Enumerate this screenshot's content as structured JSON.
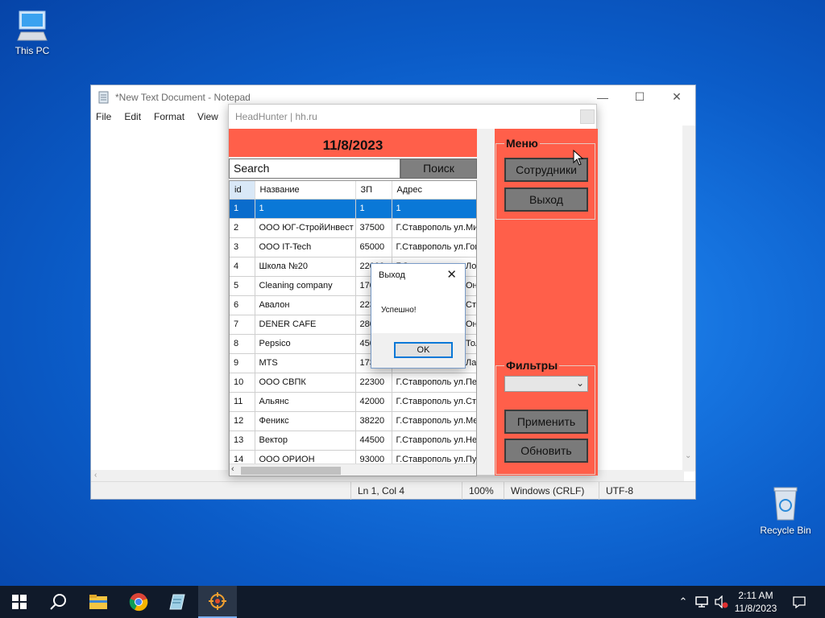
{
  "desktop": {
    "this_pc_label": "This PC",
    "recycle_bin_label": "Recycle Bin"
  },
  "notepad": {
    "title": "*New Text Document - Notepad",
    "menu": [
      "File",
      "Edit",
      "Format",
      "View",
      "H"
    ],
    "status": {
      "position": "Ln 1, Col 4",
      "zoom": "100%",
      "line_ending": "Windows (CRLF)",
      "encoding": "UTF-8"
    }
  },
  "hh": {
    "title": "HeadHunter | hh.ru",
    "date": "11/8/2023",
    "search_placeholder": "Search",
    "search_button": "Поиск",
    "columns": [
      "id",
      "Название",
      "ЗП",
      "Адрес"
    ],
    "rows": [
      [
        "1",
        "1",
        "1",
        "1"
      ],
      [
        "2",
        "ООО ЮГ-СтройИнвест",
        "37500",
        "Г.Ставрополь ул.Мир"
      ],
      [
        "3",
        "ООО IT-Tech",
        "65000",
        "Г.Ставрополь ул.Гог"
      ],
      [
        "4",
        "Школа №20",
        "22000",
        "Г.Ставрополь ул.Лог"
      ],
      [
        "5",
        "Cleaning company",
        "17000",
        "Г.Ставрополь ул.Онс"
      ],
      [
        "6",
        "Авалон",
        "22300",
        "Г.Ставрополь ул.Сте"
      ],
      [
        "7",
        "DENER CAFE",
        "28000",
        "Г.Ставрополь ул.Онс"
      ],
      [
        "8",
        "Pepsico",
        "45000",
        "Г.Ставрополь ул.Тол"
      ],
      [
        "9",
        "MTS",
        "17300",
        "Г.Ставрополь ул.Лаз"
      ],
      [
        "10",
        "ООО СВПК",
        "22300",
        "Г.Ставрополь ул.Пен"
      ],
      [
        "11",
        "Альянс",
        "42000",
        "Г.Ставрополь ул.Сте"
      ],
      [
        "12",
        "Феникс",
        "38220",
        "Г.Ставрополь ул.Мел"
      ],
      [
        "13",
        "Вектор",
        "44500",
        "Г.Ставрополь ул.Нес"
      ],
      [
        "14",
        "ООО ОРИОН",
        "93000",
        "Г.Ставрополь ул.Пуш"
      ]
    ],
    "menu_group_label": "Меню",
    "employees_button": "Сотрудники",
    "exit_button": "Выход",
    "filters_group_label": "Фильтры",
    "apply_button": "Применить",
    "refresh_button": "Обновить",
    "accent_color": "#ff5f4a"
  },
  "dialog": {
    "title": "Выход",
    "message": "Успешно!",
    "ok_button": "OK"
  },
  "taskbar": {
    "time": "2:11 AM",
    "date": "11/8/2023",
    "icons": [
      "windows-start-icon",
      "search-icon",
      "file-explorer-icon",
      "chrome-icon",
      "notepad-icon",
      "target-app-icon"
    ]
  }
}
